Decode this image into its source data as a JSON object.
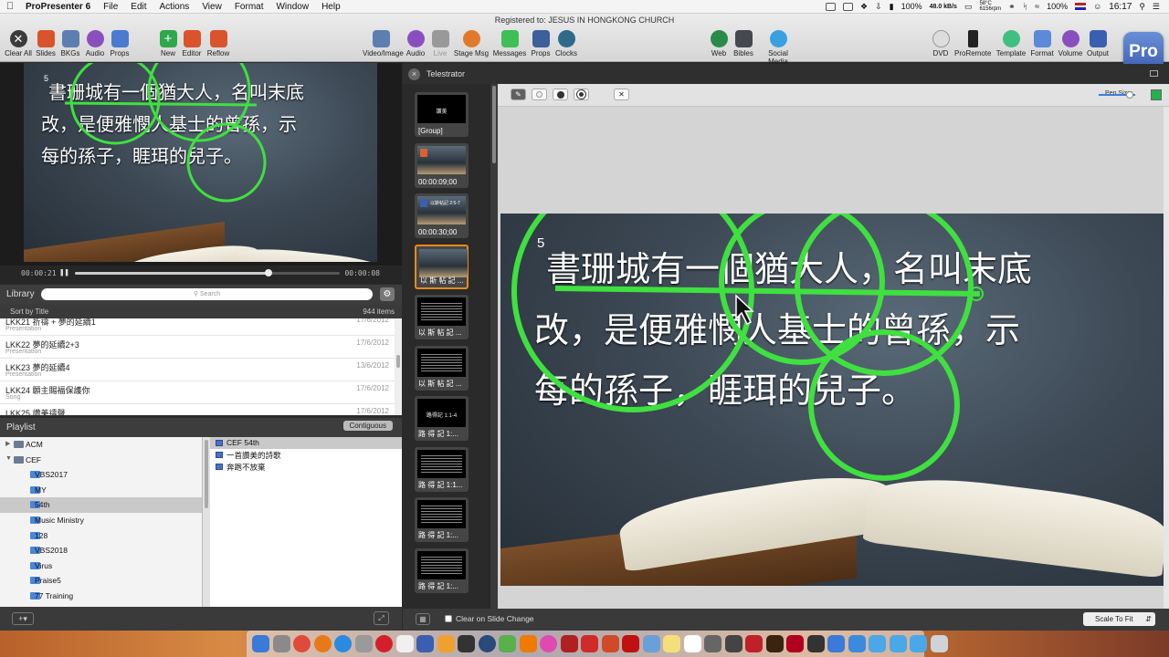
{
  "menubar": {
    "app_name": "ProPresenter 6",
    "menus": [
      "File",
      "Edit",
      "Actions",
      "View",
      "Format",
      "Window",
      "Help"
    ],
    "battery_pct": "100%",
    "net_speed": "48.0 kB/s",
    "temp": "58°C",
    "rpm": "6156rpm",
    "battery2_pct": "100%",
    "time": "16:17"
  },
  "toolbar": {
    "registered": "Registered to: JESUS IN HONGKONG CHURCH",
    "left_buttons": [
      {
        "label": "Clear All",
        "color": "#3b3b3b",
        "icon": "clear-icon"
      },
      {
        "label": "Slides",
        "color": "#d9532c",
        "icon": "slides-icon"
      },
      {
        "label": "BKGs",
        "color": "#5c7fb0",
        "icon": "backgrounds-icon"
      },
      {
        "label": "Audio",
        "color": "#8a4fbf",
        "icon": "audio-icon"
      },
      {
        "label": "Props",
        "color": "#4a7bcf",
        "icon": "props-icon"
      },
      {
        "label": "New",
        "color": "#2ea84a",
        "icon": "new-icon"
      },
      {
        "label": "Editor",
        "color": "#d9532c",
        "icon": "editor-icon"
      },
      {
        "label": "Reflow",
        "color": "#d9532c",
        "icon": "reflow-icon"
      }
    ],
    "mid_buttons": [
      {
        "label": "Video/Image",
        "color": "#5c7fb0",
        "icon": "video-image-icon"
      },
      {
        "label": "Audio",
        "color": "#8a4fbf",
        "icon": "audio-bin-icon"
      },
      {
        "label": "Live",
        "color": "#999999",
        "icon": "live-video-icon"
      },
      {
        "label": "Stage Msg",
        "color": "#e07a2a",
        "icon": "stage-message-icon"
      },
      {
        "label": "Messages",
        "color": "#3fbf55",
        "icon": "messages-icon"
      },
      {
        "label": "Props",
        "color": "#3d5f9a",
        "icon": "props-bin-icon"
      },
      {
        "label": "Clocks",
        "color": "#2f6a8a",
        "icon": "clocks-icon"
      }
    ],
    "right_buttons": [
      {
        "label": "Web",
        "color": "#2a8a4a",
        "icon": "web-icon"
      },
      {
        "label": "Bibles",
        "color": "#44484f",
        "icon": "bibles-icon"
      },
      {
        "label": "Social Media",
        "color": "#3aa0e0",
        "icon": "social-media-icon"
      },
      {
        "label": "DVD",
        "color": "#dddddd",
        "icon": "dvd-icon"
      },
      {
        "label": "ProRemote",
        "color": "#222222",
        "icon": "proremote-icon"
      },
      {
        "label": "Template",
        "color": "#3fbf80",
        "icon": "template-icon"
      },
      {
        "label": "Format",
        "color": "#5a8ad8",
        "icon": "format-icon"
      },
      {
        "label": "Volume",
        "color": "#8a4fbf",
        "icon": "volume-icon"
      },
      {
        "label": "Output",
        "color": "#3b5fb0",
        "icon": "output-icon"
      }
    ],
    "logo": "Pro"
  },
  "preview": {
    "verse_number": "5",
    "lyrics": [
      "書珊城有一個猶大人，名叫末底",
      "改，是便雅憫人基士的曾孫，示",
      "每的孫子，睚珥的兒子。"
    ],
    "time_elapsed": "00:00:21",
    "time_remaining": "00:00:08",
    "progress": 0.73
  },
  "library": {
    "title": "Library",
    "search_placeholder": "Search",
    "sort_label": "Sort by Title",
    "count": "944 items",
    "items": [
      {
        "name": "LKK21 祈禱 + 夢的延續1",
        "type": "Presentation",
        "date": "17/6/2012"
      },
      {
        "name": "LKK22 夢的延續2+3",
        "type": "Presentation",
        "date": "17/6/2012"
      },
      {
        "name": "LKK23 夢的延續4",
        "type": "Presentation",
        "date": "13/6/2012"
      },
      {
        "name": "LKK24 願主賜福保護你",
        "type": "Song",
        "date": "17/6/2012"
      },
      {
        "name": "LKK25 讚美禱聲",
        "type": "",
        "date": "17/6/2012"
      }
    ]
  },
  "playlist": {
    "title": "Playlist",
    "mode_button": "Contiguous",
    "tree": [
      {
        "label": "ACM",
        "level": 0,
        "expanded": false
      },
      {
        "label": "CEF",
        "level": 0,
        "expanded": true
      },
      {
        "label": "VBS2017",
        "level": 1
      },
      {
        "label": "MY",
        "level": 1
      },
      {
        "label": "54th",
        "level": 1,
        "selected": true
      },
      {
        "label": "Music Ministry",
        "level": 1
      },
      {
        "label": "128",
        "level": 1
      },
      {
        "label": "VBS2018",
        "level": 1
      },
      {
        "label": "Virus",
        "level": 1
      },
      {
        "label": "Praise5",
        "level": 1
      },
      {
        "label": "77 Training",
        "level": 1
      }
    ],
    "items": [
      {
        "label": "CEF 54th",
        "selected": true
      },
      {
        "label": "一首讚美的詩歌",
        "selected": false
      },
      {
        "label": "奔跑不放棄",
        "selected": false
      }
    ]
  },
  "telestrator": {
    "title": "Telestrator",
    "pen_size_label": "Pen Size:",
    "pen_size": 0.85,
    "pen_color": "#22b24c",
    "thumbnails": [
      {
        "caption": "[Group]",
        "text": "讚美",
        "kind": "title"
      },
      {
        "caption": "00:00:09;00",
        "text": "",
        "kind": "video"
      },
      {
        "caption": "00:00:30;00",
        "text": "以斯帖記 2:5-7",
        "kind": "video"
      },
      {
        "caption": "以 斯 帖 記 ...",
        "text": "",
        "kind": "image",
        "selected": true
      },
      {
        "caption": "以 斯 帖 記 ...",
        "text": "",
        "kind": "text"
      },
      {
        "caption": "以 斯 帖 記 ...",
        "text": "",
        "kind": "text"
      },
      {
        "caption": "路 得 記 1:...",
        "text": "路得記 1:1-4",
        "kind": "title"
      },
      {
        "caption": "路 得 記 1:1...",
        "text": "",
        "kind": "text"
      },
      {
        "caption": "路 得 記 1:...",
        "text": "",
        "kind": "text"
      },
      {
        "caption": "路 得 記 1:...",
        "text": "",
        "kind": "text"
      }
    ],
    "verse_number": "5",
    "lyrics": [
      "書珊城有一個猶大人，名叫末底",
      "改，是便雅憫人基士的曾孫，示",
      "每的孫子，睚珥的兒子。"
    ],
    "clear_on_change_label": "Clear on Slide Change",
    "clear_on_change": false,
    "scale_select": "Scale To Fit"
  },
  "dock": {
    "apps": [
      {
        "name": "Finder",
        "color": "#3a7ad8"
      },
      {
        "name": "Launchpad",
        "color": "#8a8a8a"
      },
      {
        "name": "Chrome",
        "color": "#e04a3a"
      },
      {
        "name": "Firefox",
        "color": "#e8791a"
      },
      {
        "name": "Safari",
        "color": "#2a8ae0"
      },
      {
        "name": "Mail",
        "color": "#9a9a9a"
      },
      {
        "name": "Opera",
        "color": "#d41f2a"
      },
      {
        "name": "Photos",
        "color": "#f0f0f0"
      },
      {
        "name": "ProPresenter",
        "color": "#3b5fb0"
      },
      {
        "name": "Pages",
        "color": "#f0a030"
      },
      {
        "name": "Keynote",
        "color": "#333333"
      },
      {
        "name": "QuickTime",
        "color": "#2a4a7a"
      },
      {
        "name": "Maps",
        "color": "#5ab04a"
      },
      {
        "name": "VLC",
        "color": "#f07a00"
      },
      {
        "name": "iTunes",
        "color": "#e04ab0"
      },
      {
        "name": "FileZilla",
        "color": "#b02020"
      },
      {
        "name": "PDF Expert",
        "color": "#d02a2a"
      },
      {
        "name": "PowerPoint",
        "color": "#d04a2a"
      },
      {
        "name": "Acrobat",
        "color": "#c01010"
      },
      {
        "name": "Preview",
        "color": "#6aa0d8"
      },
      {
        "name": "Notes",
        "color": "#f4e07a"
      },
      {
        "name": "Calendar",
        "color": "#ffffff"
      },
      {
        "name": "Scanner",
        "color": "#666666"
      },
      {
        "name": "Audio MIDI",
        "color": "#444444"
      },
      {
        "name": "Flash",
        "color": "#c0202a"
      },
      {
        "name": "Illustrator",
        "color": "#3a2410"
      },
      {
        "name": "Flash Player",
        "color": "#b00020"
      },
      {
        "name": "Final Cut",
        "color": "#333333"
      },
      {
        "name": "Screen Sharing",
        "color": "#3a7ad8"
      },
      {
        "name": "Network",
        "color": "#3a8ae0"
      },
      {
        "name": "Downloads",
        "color": "#4aa8e8"
      },
      {
        "name": "Documents",
        "color": "#4aa8e8"
      },
      {
        "name": "Folder",
        "color": "#4aa8e8"
      },
      {
        "name": "Trash",
        "color": "#cfd3d8"
      }
    ]
  }
}
